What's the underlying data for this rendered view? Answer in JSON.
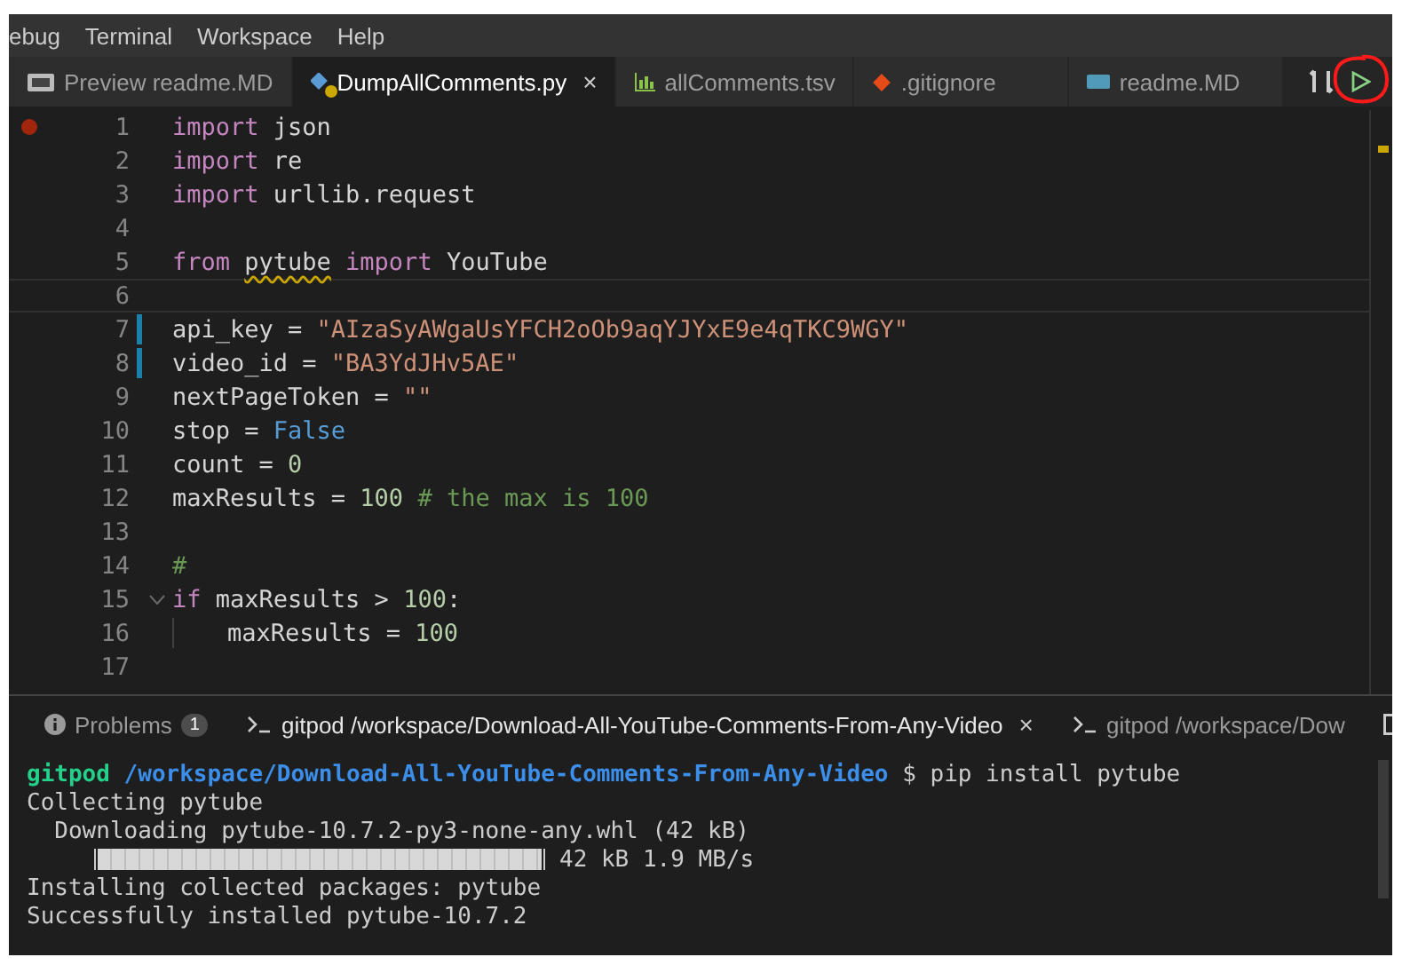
{
  "menu": [
    "ebug",
    "Terminal",
    "Workspace",
    "Help"
  ],
  "editor_tabs": [
    {
      "label": "Preview readme.MD",
      "selected": false,
      "warning": false
    },
    {
      "label": "DumpAllComments.py",
      "selected": true,
      "warning": true,
      "close": "×"
    },
    {
      "label": "allComments.tsv",
      "selected": false,
      "warning": false
    },
    {
      "label": ".gitignore",
      "selected": false,
      "warning": false
    },
    {
      "label": "readme.MD",
      "selected": false,
      "warning": false
    }
  ],
  "code_lines": [
    {
      "number": "1",
      "breakpoint": true,
      "modified": false,
      "current": false,
      "foldable": false,
      "indented": false,
      "tokens": [
        {
          "kind": "keyword",
          "text": "import"
        },
        {
          "kind": "plain",
          "text": " json"
        }
      ]
    },
    {
      "number": "2",
      "breakpoint": false,
      "modified": false,
      "current": false,
      "foldable": false,
      "indented": false,
      "tokens": [
        {
          "kind": "keyword",
          "text": "import"
        },
        {
          "kind": "plain",
          "text": " re"
        }
      ]
    },
    {
      "number": "3",
      "breakpoint": false,
      "modified": false,
      "current": false,
      "foldable": false,
      "indented": false,
      "tokens": [
        {
          "kind": "keyword",
          "text": "import"
        },
        {
          "kind": "plain",
          "text": " urllib.request"
        }
      ]
    },
    {
      "number": "4",
      "breakpoint": false,
      "modified": false,
      "current": false,
      "foldable": false,
      "indented": false
    },
    {
      "number": "5",
      "breakpoint": false,
      "modified": false,
      "current": false,
      "foldable": false,
      "indented": false,
      "tokens": [
        {
          "kind": "keyword",
          "text": "from "
        },
        {
          "kind": "plain",
          "text": "pytube",
          "squiggle": true
        },
        {
          "kind": "keyword",
          "text": " import"
        },
        {
          "kind": "plain",
          "text": " YouTube"
        }
      ]
    },
    {
      "number": "6",
      "breakpoint": false,
      "modified": false,
      "current": true,
      "foldable": false,
      "indented": false
    },
    {
      "number": "7",
      "breakpoint": false,
      "modified": true,
      "current": false,
      "foldable": false,
      "indented": false,
      "tokens": [
        {
          "kind": "plain",
          "text": "api_key = "
        },
        {
          "kind": "string",
          "text": "\"AIzaSyAWgaUsYFCH2oOb9aqYJYxE9e4qTKC9WGY\""
        }
      ]
    },
    {
      "number": "8",
      "breakpoint": false,
      "modified": true,
      "current": false,
      "foldable": false,
      "indented": false,
      "tokens": [
        {
          "kind": "plain",
          "text": "video_id = "
        },
        {
          "kind": "string",
          "text": "\"BA3YdJHv5AE\""
        }
      ]
    },
    {
      "number": "9",
      "breakpoint": false,
      "modified": false,
      "current": false,
      "foldable": false,
      "indented": false,
      "tokens": [
        {
          "kind": "plain",
          "text": "nextPageToken = "
        },
        {
          "kind": "string",
          "text": "\"\""
        }
      ]
    },
    {
      "number": "10",
      "breakpoint": false,
      "modified": false,
      "current": false,
      "foldable": false,
      "indented": false,
      "tokens": [
        {
          "kind": "plain",
          "text": "stop = "
        },
        {
          "kind": "constant",
          "text": "False"
        }
      ]
    },
    {
      "number": "11",
      "breakpoint": false,
      "modified": false,
      "current": false,
      "foldable": false,
      "indented": false,
      "tokens": [
        {
          "kind": "plain",
          "text": "count = "
        },
        {
          "kind": "number",
          "text": "0"
        }
      ]
    },
    {
      "number": "12",
      "breakpoint": false,
      "modified": false,
      "current": false,
      "foldable": false,
      "indented": false,
      "tokens": [
        {
          "kind": "plain",
          "text": "maxResults = "
        },
        {
          "kind": "number",
          "text": "100"
        },
        {
          "kind": "comment",
          "text": " # the max is 100"
        }
      ]
    },
    {
      "number": "13",
      "breakpoint": false,
      "modified": false,
      "current": false,
      "foldable": false,
      "indented": false
    },
    {
      "number": "14",
      "breakpoint": false,
      "modified": false,
      "current": false,
      "foldable": false,
      "indented": false,
      "tokens": [
        {
          "kind": "comment",
          "text": "#"
        }
      ]
    },
    {
      "number": "15",
      "breakpoint": false,
      "modified": false,
      "current": false,
      "foldable": true,
      "indented": false,
      "tokens": [
        {
          "kind": "keyword",
          "text": "if"
        },
        {
          "kind": "plain",
          "text": " maxResults > "
        },
        {
          "kind": "number",
          "text": "100"
        },
        {
          "kind": "plain",
          "text": ":"
        }
      ]
    },
    {
      "number": "16",
      "breakpoint": false,
      "modified": false,
      "current": false,
      "foldable": false,
      "indented": true,
      "tokens": [
        {
          "kind": "plain",
          "text": "maxResults = "
        },
        {
          "kind": "number",
          "text": "100"
        }
      ]
    },
    {
      "number": "17",
      "breakpoint": false,
      "modified": false,
      "current": false,
      "foldable": false,
      "indented": false
    }
  ],
  "panel_tabs": [
    {
      "kind": "problems",
      "label": "Problems",
      "badge": "1",
      "selected": false
    },
    {
      "kind": "terminal",
      "label": "gitpod /workspace/Download-All-YouTube-Comments-From-Any-Video",
      "selected": true,
      "close": "×"
    },
    {
      "kind": "terminal",
      "label": "gitpod /workspace/Dow",
      "selected": false
    }
  ],
  "terminal_lines": [
    {
      "kind": "prompt",
      "user": "gitpod",
      "path": "/workspace/Download-All-YouTube-Comments-From-Any-Video",
      "command": "$ pip install pytube"
    },
    {
      "kind": "text",
      "text": "Collecting pytube"
    },
    {
      "kind": "text",
      "text": "  Downloading pytube-10.7.2-py3-none-any.whl (42 kB)"
    },
    {
      "kind": "progress",
      "level": 1,
      "text": "42 kB 1.9 MB/s"
    },
    {
      "kind": "text",
      "text": "Installing collected packages: pytube"
    },
    {
      "kind": "text",
      "text": "Successfully installed pytube-10.7.2"
    }
  ]
}
